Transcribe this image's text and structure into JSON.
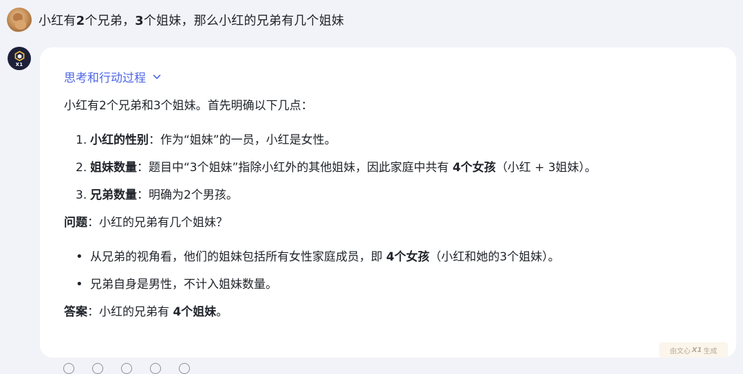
{
  "user": {
    "seg1": "小红有",
    "seg2": "2",
    "seg3": "个兄弟，",
    "seg4": "3",
    "seg5": "个姐妹，那么小红的兄弟有几个姐妹"
  },
  "assistant": {
    "thinking_label": "思考和行动过程",
    "intro": "小红有2个兄弟和3个姐妹。首先明确以下几点：",
    "points": [
      {
        "num": "1.",
        "bold": "小红的性别",
        "text_a": "：作为“姐妹”的一员，小红是女性。",
        "bold2": "",
        "text_b": ""
      },
      {
        "num": "2.",
        "bold": "姐妹数量",
        "text_a": "：题目中“3个姐妹”指除小红外的其他姐妹，因此家庭中共有 ",
        "bold2": "4个女孩",
        "text_b": "（小红 + 3姐妹）。"
      },
      {
        "num": "3.",
        "bold": "兄弟数量",
        "text_a": "：明确为2个男孩。",
        "bold2": "",
        "text_b": ""
      }
    ],
    "question_label": "问题",
    "question_text": "：小红的兄弟有几个姐妹？",
    "bullets": [
      {
        "text_a": "从兄弟的视角看，他们的姐妹包括所有女性家庭成员，即 ",
        "bold": "4个女孩",
        "text_b": "（小红和她的3个姐妹）。"
      },
      {
        "text_a": "兄弟自身是男性，不计入姐妹数量。",
        "bold": "",
        "text_b": ""
      }
    ],
    "answer_label": "答案",
    "answer_text": "：小红的兄弟有 ",
    "answer_bold": "4个姐妹",
    "answer_end": "。"
  },
  "badge": {
    "pre": "由文心",
    "brand": "X1",
    "post": "生成"
  },
  "bot_avatar_label": "X1",
  "colors": {
    "accent": "#4e66e8",
    "background": "#f2f3f8",
    "card": "#ffffff"
  }
}
